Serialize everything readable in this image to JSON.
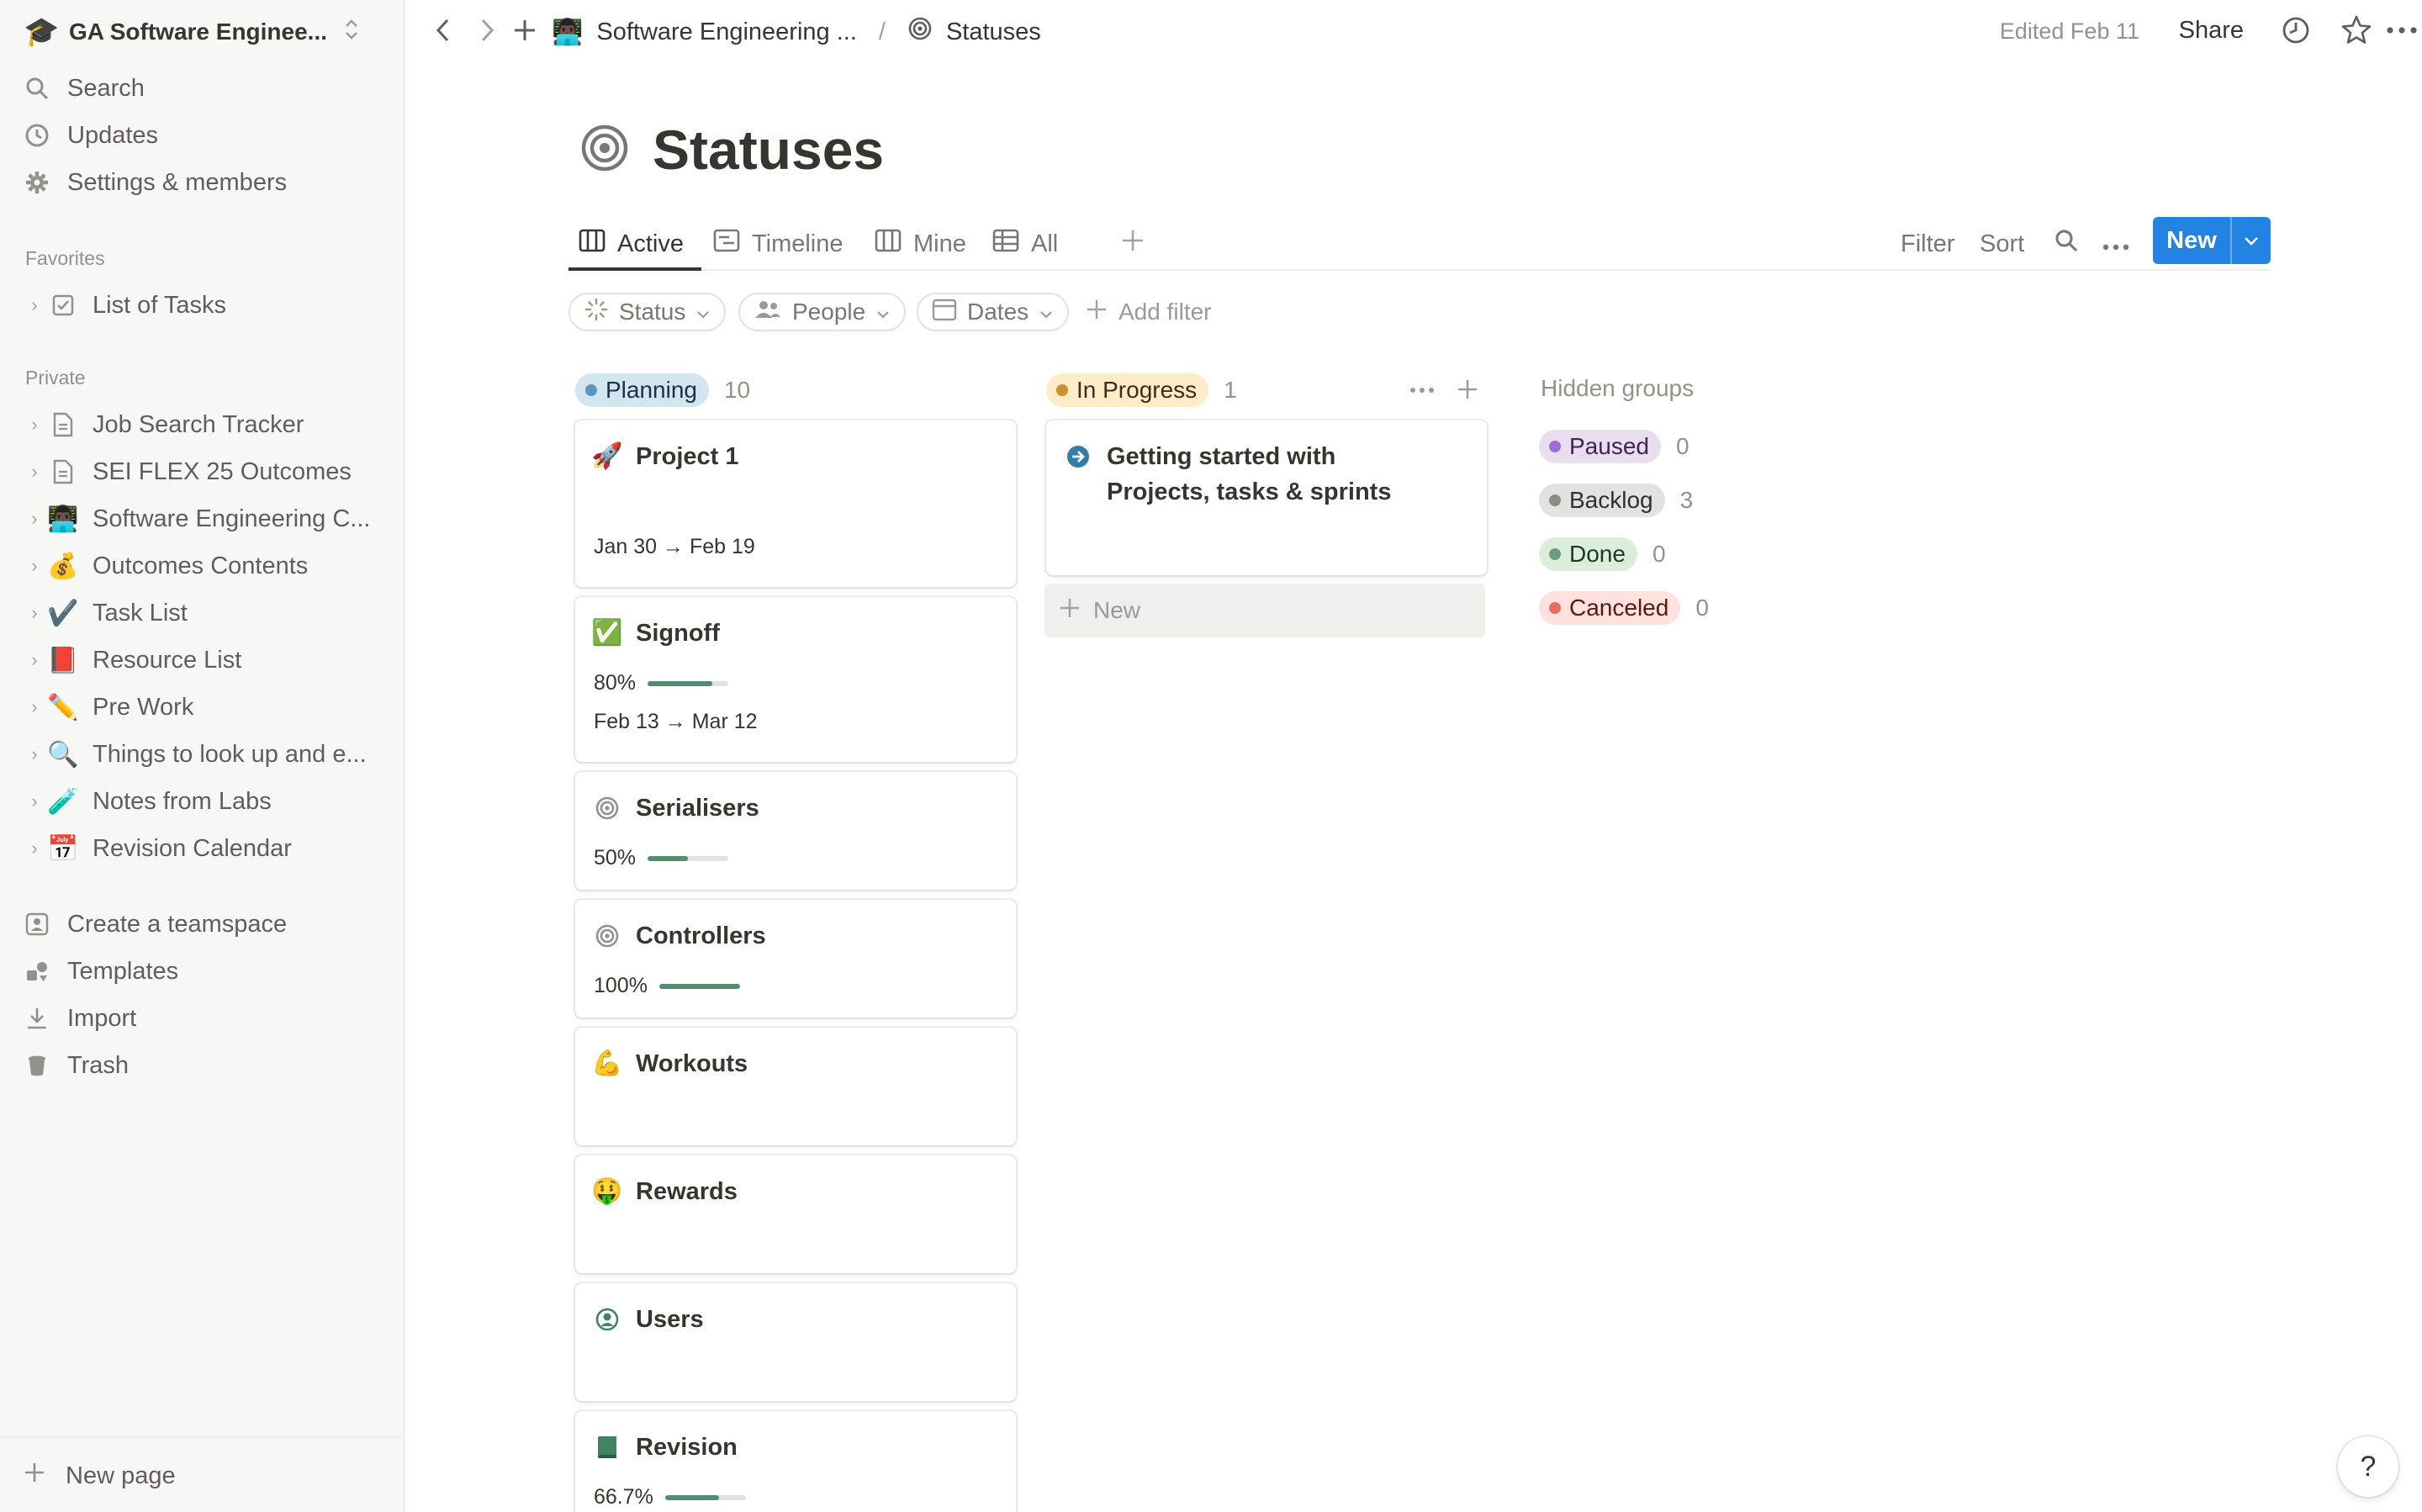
{
  "sidebar": {
    "workspace": {
      "name": "GA Software Enginee...",
      "emoji": "🎓"
    },
    "top_items": [
      {
        "label": "Search",
        "icon": "search-icon"
      },
      {
        "label": "Updates",
        "icon": "clock-icon"
      },
      {
        "label": "Settings & members",
        "icon": "gear-icon"
      }
    ],
    "favorites_label": "Favorites",
    "favorites": [
      {
        "label": "List of Tasks",
        "icon": "checkbox-icon"
      }
    ],
    "private_label": "Private",
    "private": [
      {
        "label": "Job Search Tracker",
        "emoji": "📄"
      },
      {
        "label": "SEI FLEX 25 Outcomes",
        "emoji": "📄"
      },
      {
        "label": "Software Engineering C...",
        "emoji": "👨🏿‍💻"
      },
      {
        "label": "Outcomes Contents",
        "emoji": "💰"
      },
      {
        "label": "Task List",
        "emoji": "✔️"
      },
      {
        "label": "Resource List",
        "emoji": "📕"
      },
      {
        "label": "Pre Work",
        "emoji": "✏️"
      },
      {
        "label": "Things to look up and e...",
        "emoji": "🔍"
      },
      {
        "label": "Notes from Labs",
        "emoji": "🧪"
      },
      {
        "label": "Revision Calendar",
        "emoji": "📅"
      }
    ],
    "bottom_items": [
      {
        "label": "Create a teamspace",
        "icon": "teamspace-icon"
      },
      {
        "label": "Templates",
        "icon": "templates-icon"
      },
      {
        "label": "Import",
        "icon": "import-icon"
      },
      {
        "label": "Trash",
        "icon": "trash-icon"
      }
    ],
    "new_page": "New page"
  },
  "topbar": {
    "breadcrumb": [
      {
        "label": "Software Engineering ...",
        "emoji": "👨🏿‍💻"
      },
      {
        "label": "Statuses",
        "icon": "target-icon"
      }
    ],
    "separator": "/",
    "edited": "Edited Feb 11",
    "share": "Share"
  },
  "page": {
    "title": "Statuses",
    "tabs": [
      {
        "label": "Active",
        "icon": "board-icon",
        "active": true
      },
      {
        "label": "Timeline",
        "icon": "timeline-icon"
      },
      {
        "label": "Mine",
        "icon": "board-icon"
      },
      {
        "label": "All",
        "icon": "table-icon"
      }
    ],
    "toolbar": {
      "filter": "Filter",
      "sort": "Sort",
      "new": "New"
    },
    "filters": [
      {
        "label": "Status",
        "icon": "status-icon"
      },
      {
        "label": "People",
        "icon": "people-icon"
      },
      {
        "label": "Dates",
        "icon": "calendar-icon"
      }
    ],
    "add_filter": "Add filter"
  },
  "board": {
    "columns": [
      {
        "name": "Planning",
        "count": "10",
        "bg": "#d3e5ef",
        "dot": "#5b97bd",
        "text": "#183347",
        "cards": [
          {
            "title": "Project 1",
            "emoji": "🚀",
            "date": "Jan 30 → Feb 19"
          },
          {
            "title": "Signoff",
            "emoji": "✅",
            "progress": 0.8,
            "progress_label": "80%",
            "date": "Feb 13 → Mar 12"
          },
          {
            "title": "Serialisers",
            "icon": "target-icon",
            "progress": 0.5,
            "progress_label": "50%"
          },
          {
            "title": "Controllers",
            "icon": "target-icon",
            "progress": 1.0,
            "progress_label": "100%"
          },
          {
            "title": "Workouts",
            "emoji": "💪"
          },
          {
            "title": "Rewards",
            "emoji": "🤑"
          },
          {
            "title": "Users",
            "icon": "user-circle-icon"
          },
          {
            "title": "Revision",
            "icon": "book-icon",
            "progress": 0.667,
            "progress_label": "66.7%"
          }
        ]
      },
      {
        "name": "In Progress",
        "count": "1",
        "bg": "#fdecc8",
        "dot": "#cb912f",
        "text": "#402c1b",
        "cards": [
          {
            "title": "Getting started with Projects, tasks & sprints",
            "icon": "arrow-circle-icon"
          }
        ],
        "new_label": "New"
      }
    ],
    "hidden_groups_label": "Hidden groups",
    "hidden_groups": [
      {
        "name": "Paused",
        "count": "0",
        "bg": "#e8deee",
        "dot": "#9a6dd7",
        "text": "#412454"
      },
      {
        "name": "Backlog",
        "count": "3",
        "bg": "#e3e2e0",
        "dot": "#8c8b88",
        "text": "#32302c"
      },
      {
        "name": "Done",
        "count": "0",
        "bg": "#dbeddb",
        "dot": "#6c9b7d",
        "text": "#1c3829"
      },
      {
        "name": "Canceled",
        "count": "0",
        "bg": "#ffe2dd",
        "dot": "#e16f64",
        "text": "#5d1715"
      }
    ]
  },
  "help": "?"
}
